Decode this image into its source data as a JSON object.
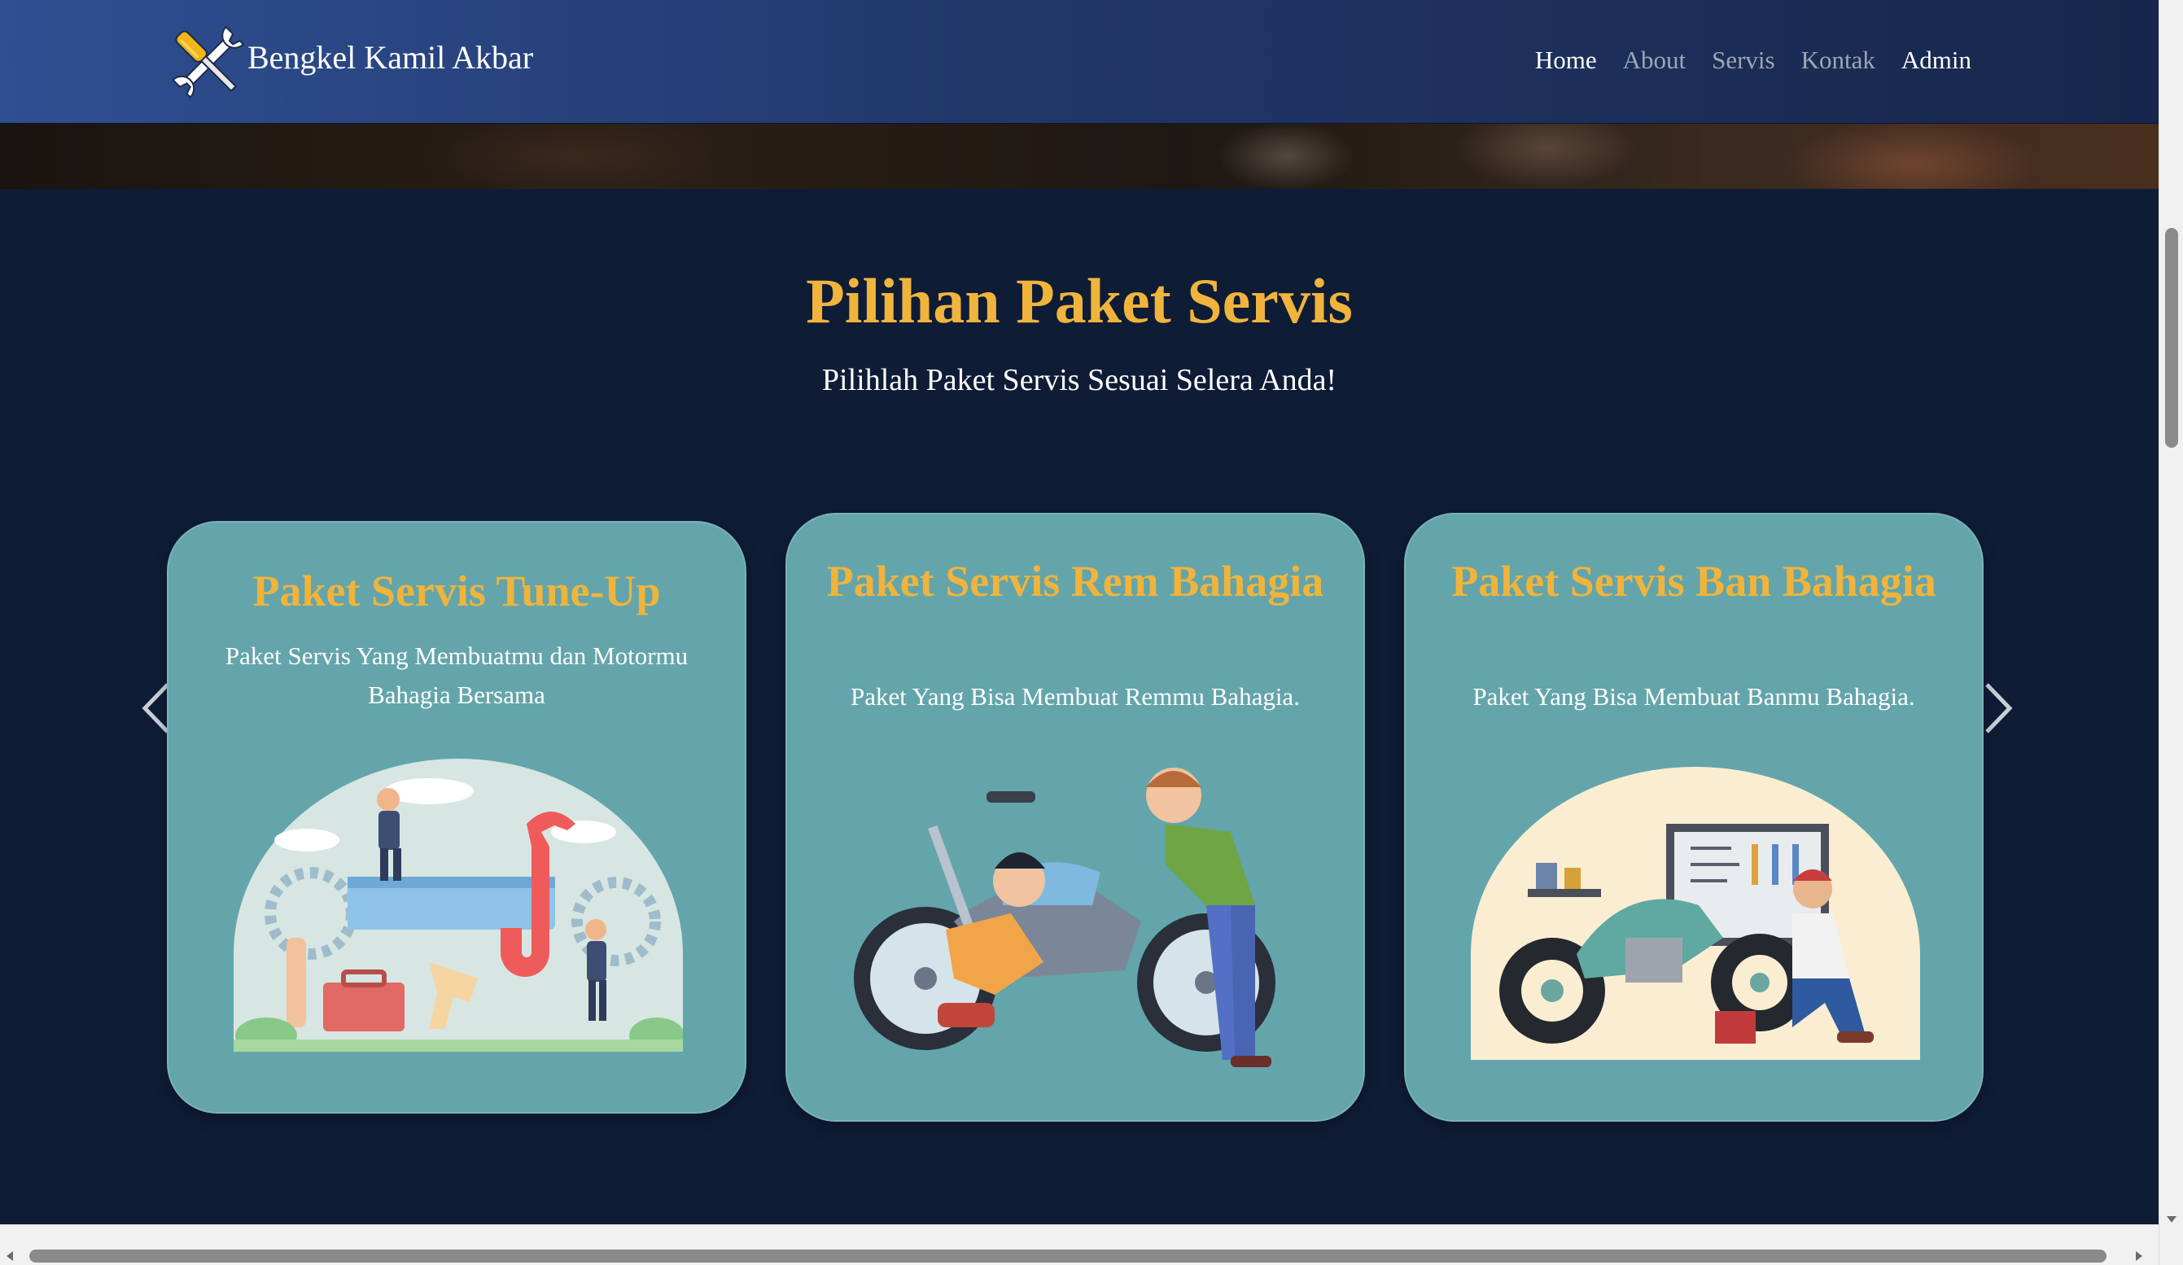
{
  "brand": {
    "name": "Bengkel Kamil Akbar",
    "logo_icon": "wrench-screwdriver-cross-icon"
  },
  "nav": {
    "items": [
      {
        "label": "Home",
        "active": true
      },
      {
        "label": "About",
        "active": false
      },
      {
        "label": "Servis",
        "active": false
      },
      {
        "label": "Kontak",
        "active": false
      },
      {
        "label": "Admin",
        "active": false
      }
    ]
  },
  "section": {
    "title": "Pilihan Paket Servis",
    "subtitle": "Pilihlah Paket Servis Sesuai Selera Anda!"
  },
  "cards": [
    {
      "title": "Paket Servis Tune-Up",
      "description": "Paket Servis Yang Membuatmu dan Motormu Bahagia Bersama",
      "illustration": "mechanics-tools-illustration"
    },
    {
      "title": "Paket Servis Rem Bahagia",
      "description": "Paket Yang Bisa Membuat Remmu Bahagia.",
      "illustration": "motorcycle-repair-illustration"
    },
    {
      "title": "Paket Servis Ban Bahagia",
      "description": "Paket Yang Bisa Membuat Banmu Bahagia.",
      "illustration": "tire-repair-illustration"
    }
  ],
  "carousel": {
    "prev_icon": "chevron-left-icon",
    "next_icon": "chevron-right-icon"
  },
  "colors": {
    "navbar_start": "#2f4f92",
    "navbar_end": "#17264b",
    "page_background": "#0f1c36",
    "accent_gold": "#f0b43c",
    "card_teal": "#63a5ab",
    "nav_inactive": "#9ea6b4"
  }
}
